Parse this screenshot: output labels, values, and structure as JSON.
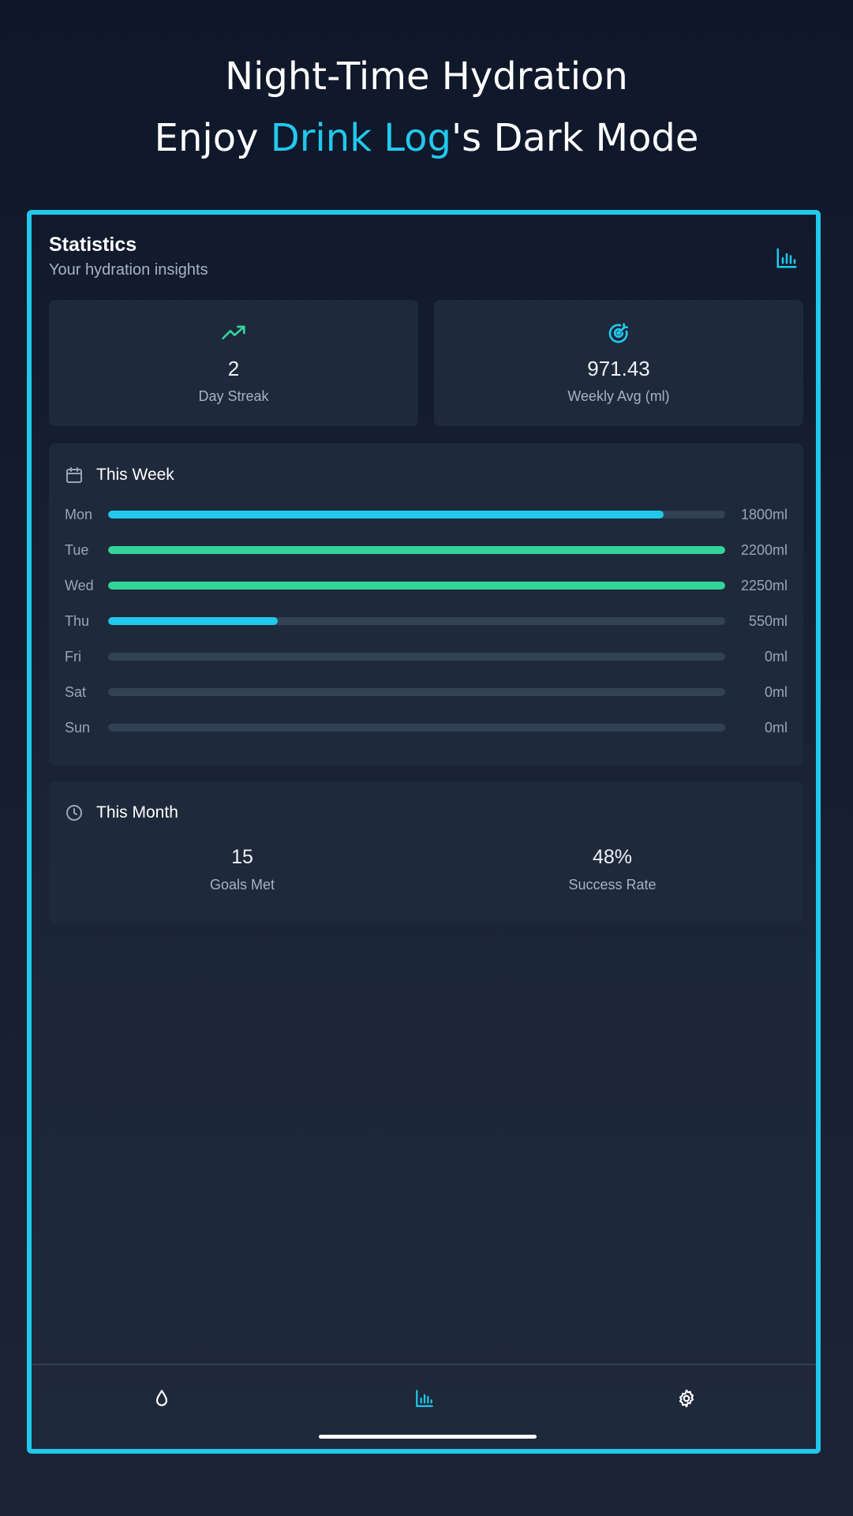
{
  "hero": {
    "line1": "Night-Time Hydration",
    "line2_prefix": "Enjoy ",
    "line2_accent": "Drink Log",
    "line2_suffix": "'s Dark Mode"
  },
  "colors": {
    "accent": "#22c8ec",
    "success": "#34d399",
    "track": "#334155",
    "card": "#1e293b"
  },
  "header": {
    "title": "Statistics",
    "subtitle": "Your hydration insights",
    "icon": "bar-chart-icon"
  },
  "stats": [
    {
      "icon": "trending-up-icon",
      "value": "2",
      "label": "Day Streak"
    },
    {
      "icon": "target-icon",
      "value": "971.43",
      "label": "Weekly Avg (ml)"
    }
  ],
  "week": {
    "title": "This Week",
    "icon": "calendar-icon",
    "days": [
      {
        "day": "Mon",
        "amount": "1800ml",
        "progress": 0.9,
        "status": "partial"
      },
      {
        "day": "Tue",
        "amount": "2200ml",
        "progress": 1.0,
        "status": "goal"
      },
      {
        "day": "Wed",
        "amount": "2250ml",
        "progress": 1.0,
        "status": "goal"
      },
      {
        "day": "Thu",
        "amount": "550ml",
        "progress": 0.275,
        "status": "partial"
      },
      {
        "day": "Fri",
        "amount": "0ml",
        "progress": 0,
        "status": "none"
      },
      {
        "day": "Sat",
        "amount": "0ml",
        "progress": 0,
        "status": "none"
      },
      {
        "day": "Sun",
        "amount": "0ml",
        "progress": 0,
        "status": "none"
      }
    ]
  },
  "month": {
    "title": "This Month",
    "icon": "clock-icon",
    "goals_met_value": "15",
    "goals_met_label": "Goals Met",
    "success_rate_value": "48%",
    "success_rate_label": "Success Rate"
  },
  "nav": {
    "items": [
      {
        "icon": "water-drop-icon",
        "active": false
      },
      {
        "icon": "bar-chart-icon",
        "active": true
      },
      {
        "icon": "gear-icon",
        "active": false
      }
    ]
  }
}
